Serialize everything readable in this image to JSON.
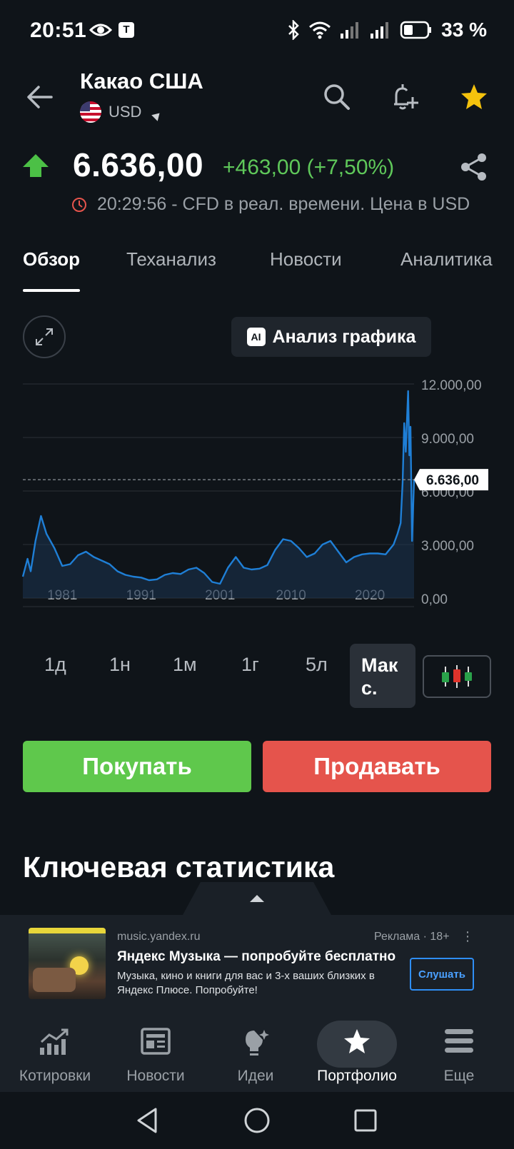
{
  "status_bar": {
    "time": "20:51",
    "t_badge": "T",
    "battery": "33 %"
  },
  "header": {
    "title": "Какао США",
    "currency": "USD"
  },
  "quote": {
    "price": "6.636,00",
    "change": "+463,00 (+7,50%)",
    "realtime_text": "20:29:56 - CFD в реал. времени. Цена в USD",
    "up_color": "#5fc85a"
  },
  "tabs": [
    "Обзор",
    "Теханализ",
    "Новости",
    "Аналитика"
  ],
  "chart_controls": {
    "ai_badge": "AI",
    "ai_label": "Анализ графика"
  },
  "chart_data": {
    "type": "area",
    "x_ticks": [
      "1981",
      "1991",
      "2001",
      "2010",
      "2020"
    ],
    "y_ticks": [
      "12.000,00",
      "9.000,00",
      "6.000,00",
      "3.000,00",
      "0,00"
    ],
    "ylim": [
      0,
      12000
    ],
    "xlim": [
      1976,
      2025.6
    ],
    "current_label": "6.636,00",
    "current_value": 6636,
    "line_color": "#1f7fd6",
    "series": [
      {
        "x": [
          1976,
          1976.6,
          1977,
          1977.6,
          1978.3,
          1979,
          1980,
          1981,
          1982,
          1983,
          1984,
          1985,
          1986,
          1987,
          1988,
          1989,
          1990,
          1991,
          1992,
          1993,
          1994,
          1995,
          1996,
          1997,
          1998,
          1999,
          2000,
          2001,
          2002,
          2003,
          2004,
          2005,
          2006,
          2007,
          2008,
          2009,
          2010,
          2011,
          2012,
          2013,
          2014,
          2015,
          2016,
          2017,
          2018,
          2019,
          2020,
          2021,
          2022,
          2023,
          2023.5,
          2023.9,
          2024.15,
          2024.35,
          2024.55,
          2024.7,
          2024.85,
          2025.0,
          2025.15,
          2025.35,
          2025.6
        ],
        "y": [
          1200,
          2200,
          1500,
          3200,
          4600,
          3600,
          2800,
          1800,
          1900,
          2400,
          2600,
          2300,
          2100,
          1900,
          1500,
          1300,
          1200,
          1150,
          1000,
          1050,
          1300,
          1400,
          1350,
          1600,
          1700,
          1400,
          900,
          800,
          1700,
          2300,
          1700,
          1600,
          1650,
          1850,
          2700,
          3300,
          3200,
          2800,
          2300,
          2500,
          3000,
          3200,
          2600,
          2000,
          2300,
          2450,
          2500,
          2500,
          2450,
          3000,
          3600,
          4200,
          6500,
          9800,
          8200,
          10000,
          11600,
          8000,
          9600,
          3200,
          6636
        ]
      }
    ]
  },
  "periods": [
    "1д",
    "1н",
    "1м",
    "1г",
    "5л"
  ],
  "period_max_line1": "Мак",
  "period_max_line2": "с.",
  "actions": {
    "buy": "Покупать",
    "sell": "Продавать"
  },
  "section_title": "Ключевая статистика",
  "ad": {
    "domain": "music.yandex.ru",
    "tag": "Реклама · 18+",
    "menu": "⋮",
    "title": "Яндекс Музыка — попробуйте бесплатно",
    "description": "Музыка, кино и книги для вас и 3-х ваших близких в Яндекс Плюсе. Попробуйте!",
    "button": "Слушать"
  },
  "bottom_nav": [
    {
      "label": "Котировки",
      "icon": "chart-up-icon"
    },
    {
      "label": "Новости",
      "icon": "newspaper-icon"
    },
    {
      "label": "Идеи",
      "icon": "lightbulb-icon"
    },
    {
      "label": "Портфолио",
      "icon": "star-icon",
      "active": true
    },
    {
      "label": "Еще",
      "icon": "menu-icon"
    }
  ]
}
